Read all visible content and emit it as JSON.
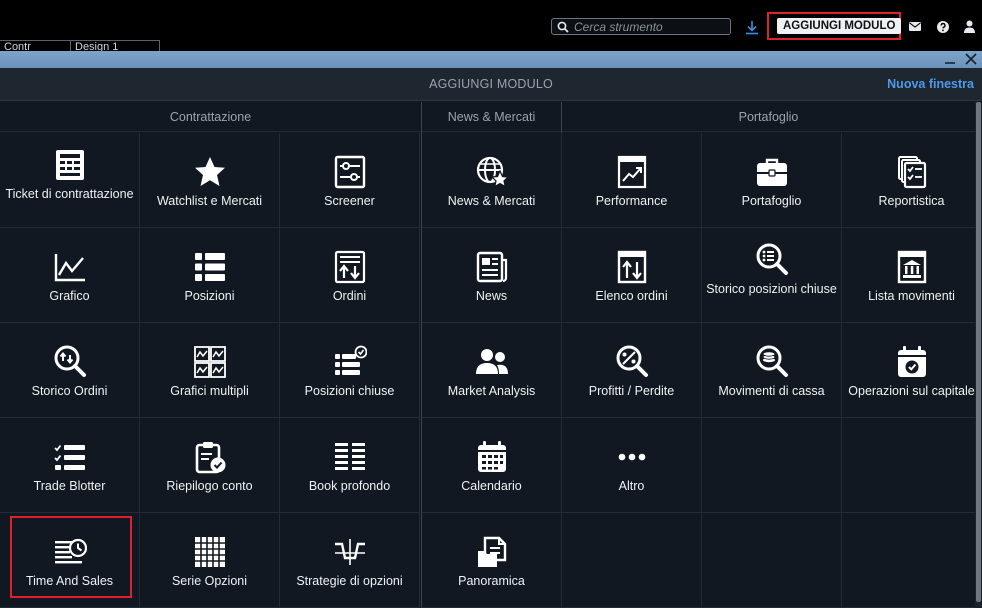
{
  "topbar": {
    "search_placeholder": "Cerca strumento",
    "add_module_label": "AGGIUNGI MODULO",
    "icons": [
      "download-icon",
      "mail-icon",
      "help-icon",
      "user-icon"
    ]
  },
  "under_tabs": [
    {
      "label": "Contr"
    },
    {
      "label": "Design 1"
    }
  ],
  "modal": {
    "title": "AGGIUNGI MODULO",
    "new_window": "Nuova finestra",
    "sections": [
      {
        "label": "Contrattazione"
      },
      {
        "label": "News & Mercati"
      },
      {
        "label": "Portafoglio"
      }
    ],
    "items": [
      {
        "label": "Ticket di contrattazione",
        "icon": "ticket-icon"
      },
      {
        "label": "Watchlist e Mercati",
        "icon": "star-icon"
      },
      {
        "label": "Screener",
        "icon": "screener-icon"
      },
      {
        "label": "News & Mercati",
        "icon": "globe-star-icon"
      },
      {
        "label": "Performance",
        "icon": "performance-chart-icon"
      },
      {
        "label": "Portafoglio",
        "icon": "briefcase-icon"
      },
      {
        "label": "Reportistica",
        "icon": "report-icon"
      },
      {
        "label": "Grafico",
        "icon": "line-chart-icon"
      },
      {
        "label": "Posizioni",
        "icon": "list-icon"
      },
      {
        "label": "Ordini",
        "icon": "orders-icon"
      },
      {
        "label": "News",
        "icon": "newspaper-icon"
      },
      {
        "label": "Elenco ordini",
        "icon": "order-list-icon"
      },
      {
        "label": "Storico posizioni chiuse",
        "icon": "search-list-icon"
      },
      {
        "label": "Lista movimenti",
        "icon": "bank-icon"
      },
      {
        "label": "Storico Ordini",
        "icon": "history-search-icon"
      },
      {
        "label": "Grafici multipli",
        "icon": "multi-chart-icon"
      },
      {
        "label": "Posizioni chiuse",
        "icon": "closed-positions-icon"
      },
      {
        "label": "Market Analysis",
        "icon": "people-icon"
      },
      {
        "label": "Profitti / Perdite",
        "icon": "profit-loss-icon"
      },
      {
        "label": "Movimenti di cassa",
        "icon": "cash-search-icon"
      },
      {
        "label": "Operazioni sul capitale",
        "icon": "calendar-check-icon"
      },
      {
        "label": "Trade Blotter",
        "icon": "checklist-icon"
      },
      {
        "label": "Riepilogo conto",
        "icon": "clipboard-check-icon"
      },
      {
        "label": "Book profondo",
        "icon": "depth-book-icon"
      },
      {
        "label": "Calendario",
        "icon": "calendar-icon"
      },
      {
        "label": "Altro",
        "icon": "more-dots-icon"
      },
      {
        "label": "Time And Sales",
        "icon": "time-sales-icon"
      },
      {
        "label": "Serie Opzioni",
        "icon": "grid-icon"
      },
      {
        "label": "Strategie di opzioni",
        "icon": "options-strategy-icon"
      },
      {
        "label": "Panoramica",
        "icon": "overview-icon"
      }
    ]
  }
}
